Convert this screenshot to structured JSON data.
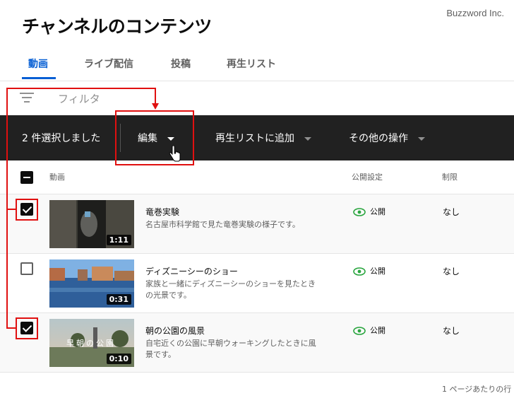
{
  "watermark": "Buzzword Inc.",
  "page_title": "チャンネルのコンテンツ",
  "tabs": [
    {
      "label": "動画",
      "active": true
    },
    {
      "label": "ライブ配信",
      "active": false
    },
    {
      "label": "投稿",
      "active": false
    },
    {
      "label": "再生リスト",
      "active": false
    }
  ],
  "filter": {
    "placeholder": "フィルタ",
    "icon": "filter-icon"
  },
  "action_bar": {
    "selected_text": "2 件選択しました",
    "edit_label": "編集",
    "add_to_playlist_label": "再生リストに追加",
    "other_actions_label": "その他の操作"
  },
  "table": {
    "headers": {
      "video": "動画",
      "visibility": "公開設定",
      "restriction": "制限"
    },
    "rows": [
      {
        "checked": true,
        "title": "竜巻実験",
        "description": "名古屋市科学館で見た竜巻実験の様子です。",
        "duration": "1:11",
        "visibility": "公開",
        "restriction": "なし"
      },
      {
        "checked": false,
        "title": "ディズニーシーのショー",
        "description": "家族と一緒にディズニーシーのショーを見たときの光景です。",
        "duration": "0:31",
        "visibility": "公開",
        "restriction": "なし"
      },
      {
        "checked": true,
        "title": "朝の公園の風景",
        "description": "自宅近くの公園に早朝ウォーキングしたときに風景です。",
        "duration": "0:10",
        "thumb_caption": "早朝の公園",
        "visibility": "公開",
        "restriction": "なし"
      }
    ]
  },
  "footer": {
    "rows_per_page": "1 ページあたりの行"
  },
  "colors": {
    "accent": "#065fd4",
    "action_bar": "#212121",
    "annotation": "#e01010",
    "visibility_icon": "#2ba640"
  }
}
